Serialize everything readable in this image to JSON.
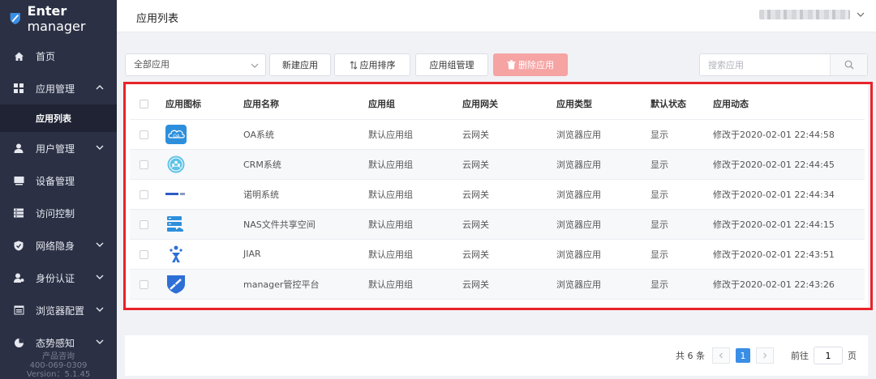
{
  "brand": {
    "bold": "Enter",
    "light": " manager"
  },
  "sidebar": {
    "items": [
      {
        "label": "首页",
        "icon": "home-icon",
        "expandable": false
      },
      {
        "label": "应用管理",
        "icon": "apps-icon",
        "expandable": true,
        "expanded": true
      },
      {
        "label": "用户管理",
        "icon": "user-icon",
        "expandable": true
      },
      {
        "label": "设备管理",
        "icon": "device-icon",
        "expandable": false
      },
      {
        "label": "访问控制",
        "icon": "access-icon",
        "expandable": false
      },
      {
        "label": "网络隐身",
        "icon": "shield-icon",
        "expandable": true
      },
      {
        "label": "身份认证",
        "icon": "identity-icon",
        "expandable": true
      },
      {
        "label": "浏览器配置",
        "icon": "browser-icon",
        "expandable": true
      },
      {
        "label": "态势感知",
        "icon": "awareness-icon",
        "expandable": true
      }
    ],
    "active_sub": "应用列表",
    "footer": {
      "line1": "产品咨询",
      "line2": "400-069-0309",
      "line3": "Version：5.1.45"
    }
  },
  "header": {
    "title": "应用列表"
  },
  "toolbar": {
    "select_value": "全部应用",
    "new_app": "新建应用",
    "sort_app": "应用排序",
    "group_manage": "应用组管理",
    "delete_app": "删除应用",
    "search_placeholder": "搜索应用"
  },
  "table": {
    "columns": [
      "应用图标",
      "应用名称",
      "应用组",
      "应用网关",
      "应用类型",
      "默认状态",
      "应用动态"
    ],
    "rows": [
      {
        "icon": "oa-icon",
        "name": "OA系统",
        "group": "默认应用组",
        "gateway": "云网关",
        "type": "浏览器应用",
        "status": "显示",
        "activity": "修改于2020-02-01 22:44:58"
      },
      {
        "icon": "crm-icon",
        "name": "CRM系统",
        "group": "默认应用组",
        "gateway": "云网关",
        "type": "浏览器应用",
        "status": "显示",
        "activity": "修改于2020-02-01 22:44:45"
      },
      {
        "icon": "nuoming-logo-icon",
        "name": "诺明系统",
        "group": "默认应用组",
        "gateway": "云网关",
        "type": "浏览器应用",
        "status": "显示",
        "activity": "修改于2020-02-01 22:44:34"
      },
      {
        "icon": "nas-icon",
        "name": "NAS文件共享空间",
        "group": "默认应用组",
        "gateway": "云网关",
        "type": "浏览器应用",
        "status": "显示",
        "activity": "修改于2020-02-01 22:44:15"
      },
      {
        "icon": "jira-icon",
        "name": "JIAR",
        "group": "默认应用组",
        "gateway": "云网关",
        "type": "浏览器应用",
        "status": "显示",
        "activity": "修改于2020-02-01 22:43:51"
      },
      {
        "icon": "manager-icon",
        "name": "manager管控平台",
        "group": "默认应用组",
        "gateway": "云网关",
        "type": "浏览器应用",
        "status": "显示",
        "activity": "修改于2020-02-01 22:43:26"
      }
    ]
  },
  "pagination": {
    "total": "共 6 条",
    "current": "1",
    "goto_label": "前往",
    "goto_value": "1",
    "page_unit": "页"
  },
  "colors": {
    "sidebar": "#2b3044",
    "accent": "#3a8ee6",
    "danger": "#f6a3a3",
    "highlight": "#e8232a"
  }
}
